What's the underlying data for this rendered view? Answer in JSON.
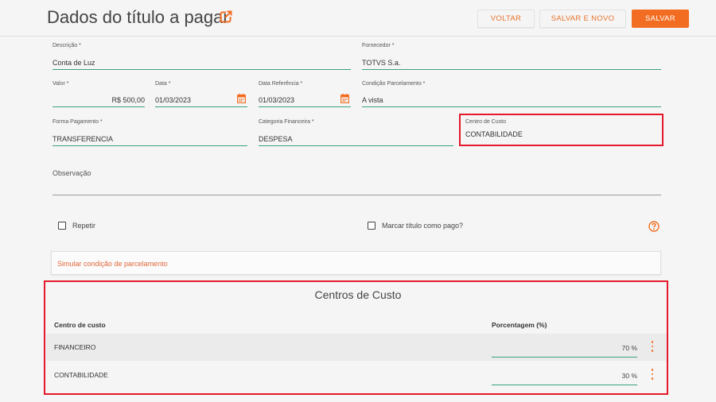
{
  "header": {
    "title": "Dados do título a pagar",
    "back_label": "VOLTAR",
    "save_new_label": "SALVAR E NOVO",
    "save_label": "SALVAR"
  },
  "form": {
    "descricao": {
      "label": "Descrição *",
      "value": "Conta de Luz"
    },
    "fornecedor": {
      "label": "Fornecedor *",
      "value": "TOTVS S.a."
    },
    "valor": {
      "label": "Valor *",
      "value": "R$ 500,00"
    },
    "data": {
      "label": "Data *",
      "value": "01/03/2023"
    },
    "data_referencia": {
      "label": "Data Referência *",
      "value": "01/03/2023"
    },
    "condicao_parcelamento": {
      "label": "Condição Parcelamento *",
      "value": "A vista"
    },
    "forma_pagamento": {
      "label": "Forma Pagamento *",
      "value": "TRANSFERENCIA"
    },
    "categoria_financeira": {
      "label": "Categoria Financeira *",
      "value": "DESPESA"
    },
    "centro_custo": {
      "label": "Centro de Custo",
      "value": "CONTABILIDADE"
    },
    "observacao": {
      "label": "Observação",
      "value": ""
    },
    "repetir": {
      "label": "Repetir",
      "checked": false
    },
    "marcar_pago": {
      "label": "Marcar título como pago?",
      "checked": false
    },
    "simular_label": "Simular condição de parcelamento"
  },
  "centros": {
    "title": "Centros de Custo",
    "col_centro": "Centro de custo",
    "col_percent": "Porcentagem (%)",
    "rows": [
      {
        "name": "FINANCEIRO",
        "percent": "70 %"
      },
      {
        "name": "CONTABILIDADE",
        "percent": "30 %"
      }
    ]
  },
  "colors": {
    "accent": "#f26d21",
    "underline": "#38a37a",
    "highlight_box": "#e5192a"
  }
}
